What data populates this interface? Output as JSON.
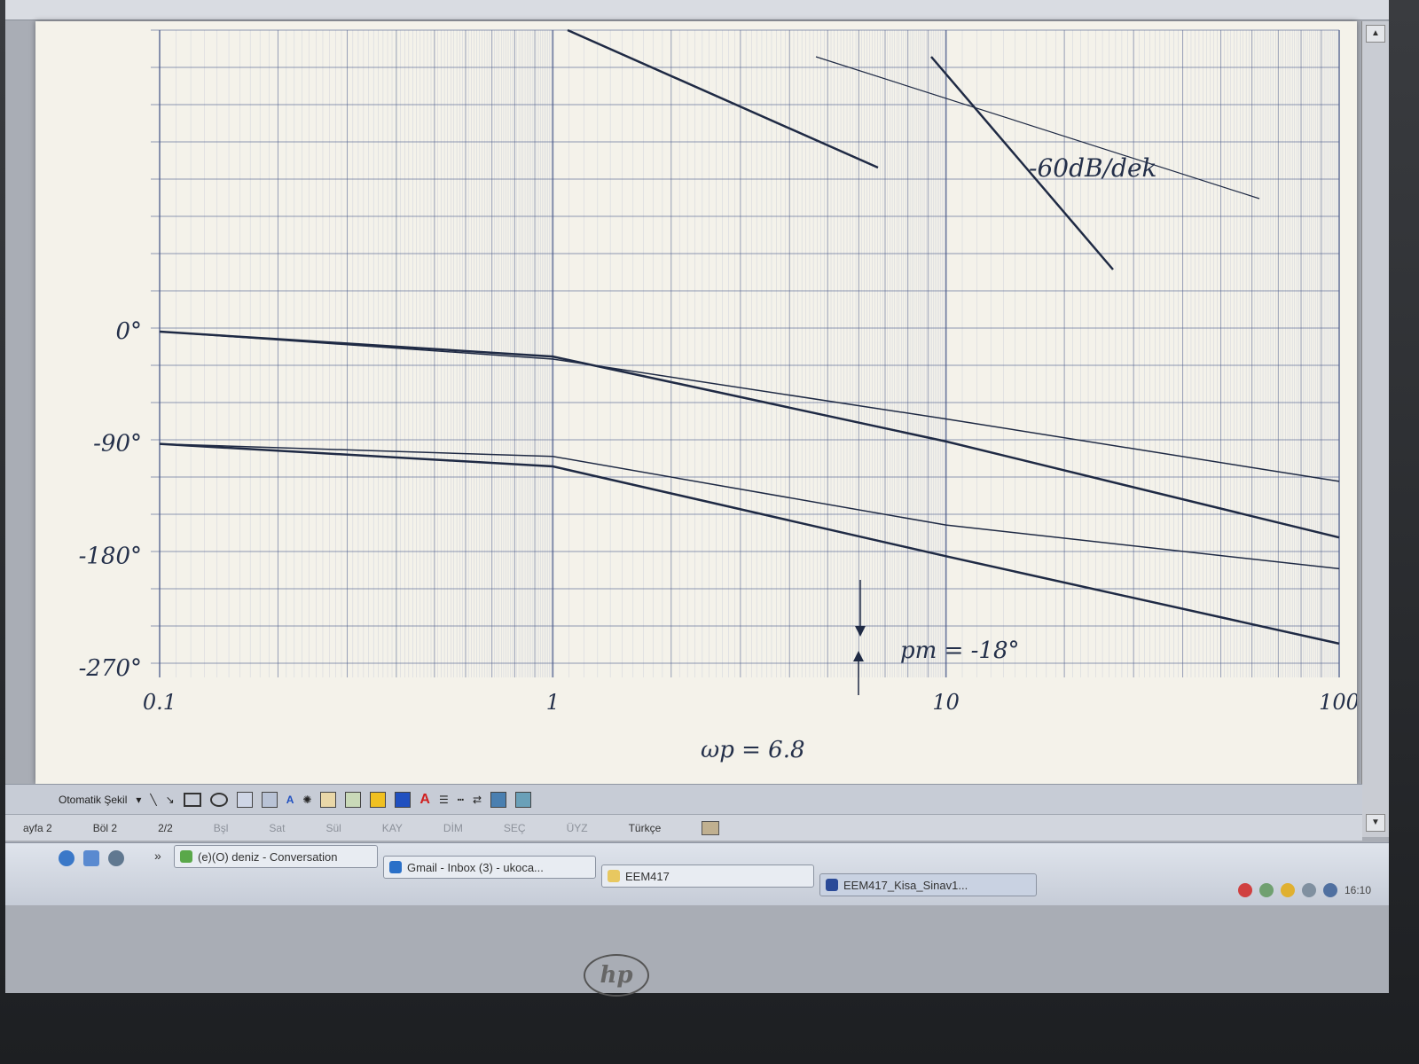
{
  "document": {
    "axis": {
      "phase_ticks": [
        "0°",
        "-90°",
        "-180°",
        "-270°"
      ],
      "freq_ticks": [
        "0.1",
        "1",
        "10",
        "100"
      ]
    },
    "annotations": {
      "slope": "-60dB/dek",
      "phase_margin": "pm = -18°",
      "crossover": "ωp = 6.8"
    }
  },
  "draw_toolbar": {
    "autoshapes_label": "Otomatik Şekil",
    "colors": {
      "fill": "#f0c020",
      "line": "#2050c0",
      "font": "#d02020"
    }
  },
  "status_bar": {
    "page": "ayfa 2",
    "section": "Böl 2",
    "pages": "2/2",
    "at": "Bşl",
    "line": "Sat",
    "col": "Sül",
    "modes": [
      "KAY",
      "DİM",
      "SEÇ",
      "ÜYZ"
    ],
    "language": "Türkçe"
  },
  "taskbar": {
    "quick_launch_more": "»",
    "buttons": [
      "(e)(O) deniz - Conversation",
      "Gmail - Inbox (3) - ukoca...",
      "EEM417",
      "EEM417_Kisa_Sinav1..."
    ],
    "clock": "16:10"
  },
  "monitor": {
    "brand": "hp"
  },
  "chart_data": {
    "type": "line",
    "title": "",
    "xlabel": "",
    "ylabel": "",
    "x_scale": "log",
    "xlim": [
      0.1,
      100
    ],
    "ylim": [
      -270,
      0
    ],
    "grid": true,
    "x_ticks": [
      "0.1",
      "1",
      "10",
      "100"
    ],
    "y_ticks": [
      "0°",
      "-90°",
      "-180°",
      "-270°"
    ],
    "series": [
      {
        "x": [
          0.1,
          1,
          10,
          100
        ],
        "y": [
          0,
          -20,
          -88,
          -165
        ]
      },
      {
        "x": [
          0.1,
          1,
          10,
          100
        ],
        "y": [
          0,
          -22,
          -70,
          -120
        ]
      },
      {
        "x": [
          0.1,
          1,
          10,
          100
        ],
        "y": [
          -90,
          -108,
          -180,
          -250
        ]
      },
      {
        "x": [
          0.1,
          1,
          10,
          100
        ],
        "y": [
          -90,
          -100,
          -155,
          -190
        ]
      }
    ]
  }
}
